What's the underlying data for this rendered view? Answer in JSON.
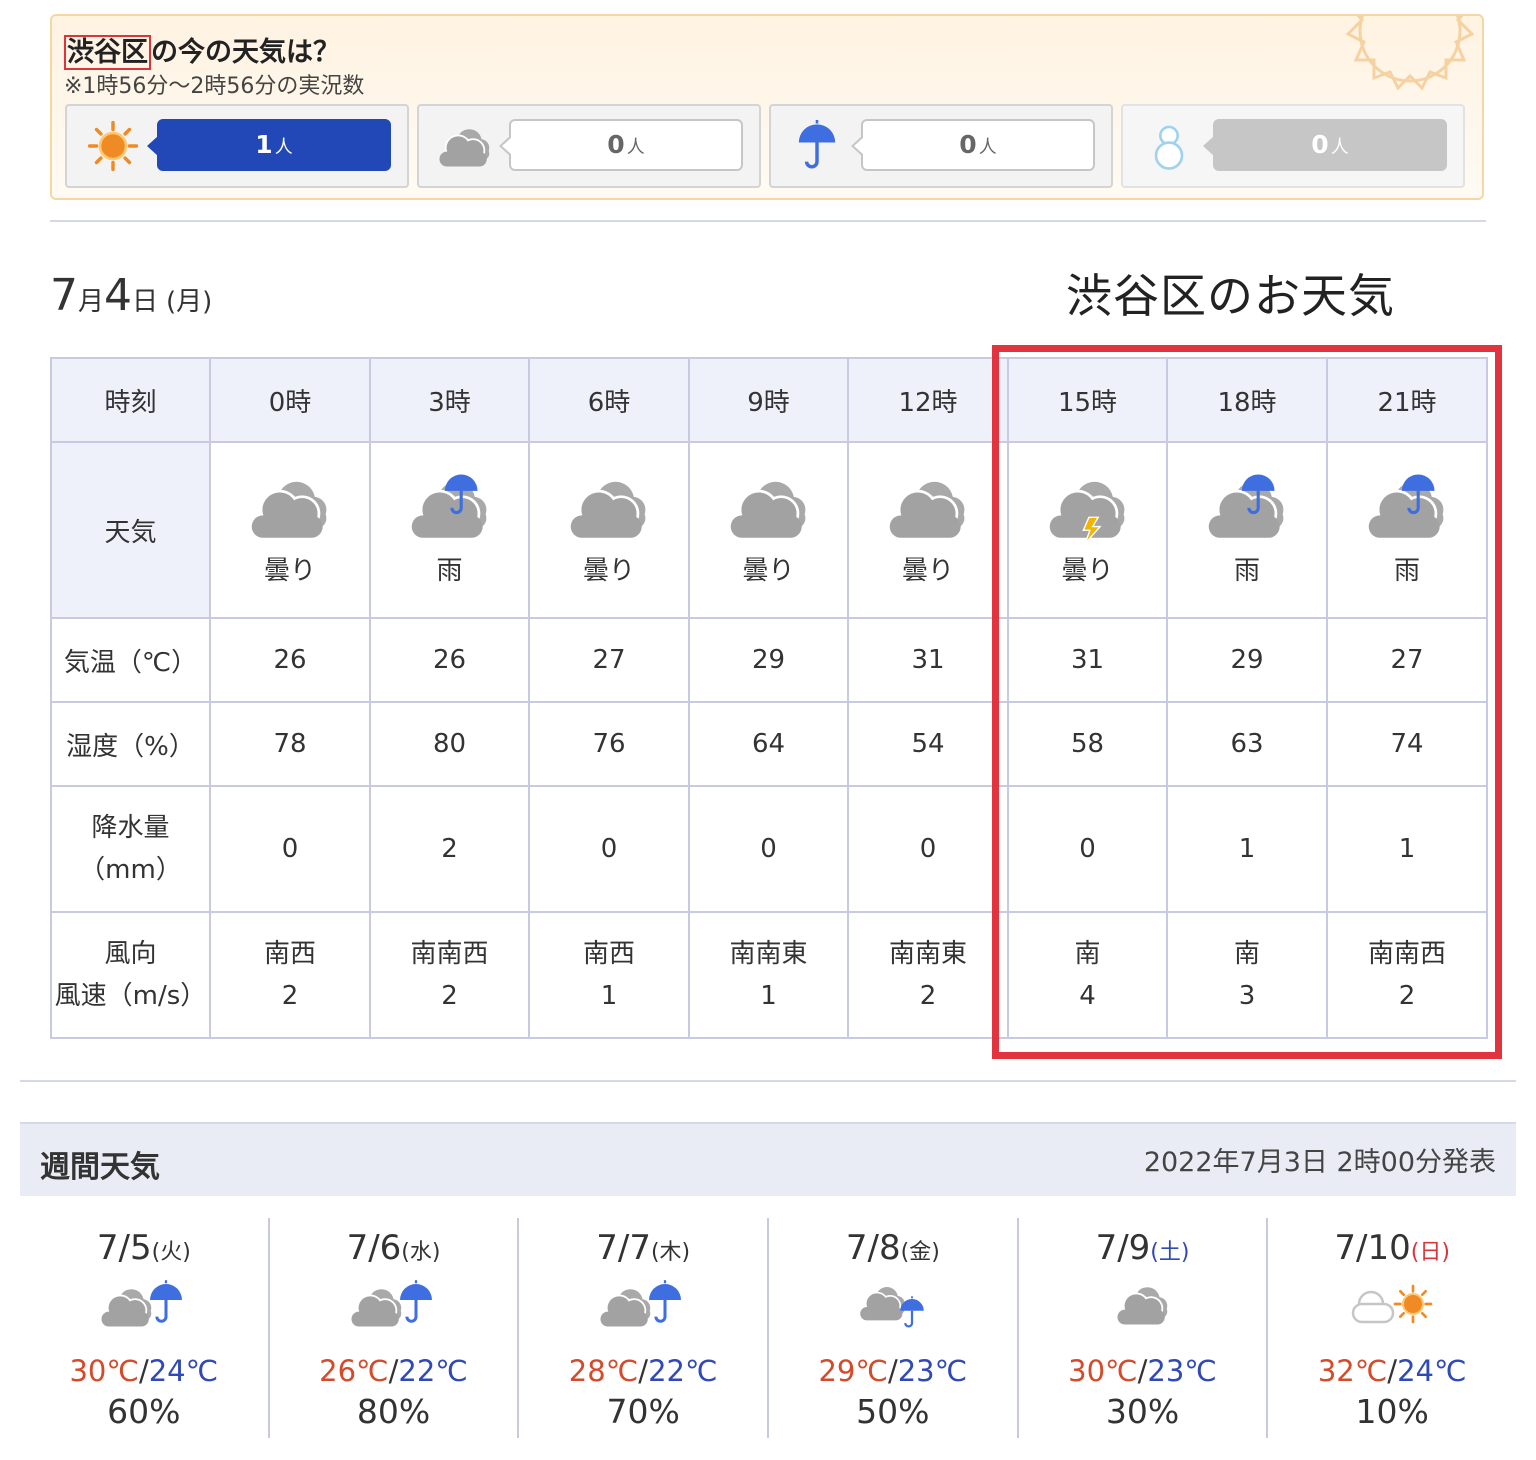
{
  "live": {
    "place": "渋谷区",
    "title_suffix": "の今の天気は？",
    "subtitle": "※1時56分〜2時56分の実況数",
    "unit": "人",
    "votes": [
      {
        "icon": "sun-icon",
        "count": "1"
      },
      {
        "icon": "cloud-icon",
        "count": "0"
      },
      {
        "icon": "umbrella-icon",
        "count": "0"
      },
      {
        "icon": "snowman-icon",
        "count": "0"
      }
    ]
  },
  "date": {
    "month": "7",
    "month_unit": "月",
    "day": "4",
    "day_unit": "日",
    "dow": "(月)"
  },
  "annotation": "渋谷区のお天気",
  "hourly": {
    "labels": {
      "time": "時刻",
      "weather": "天気",
      "temp": "気温（℃）",
      "humidity": "湿度（%）",
      "precip_1": "降水量",
      "precip_2": "（mm）",
      "wind_1": "風向",
      "wind_2": "風速（m/s）"
    },
    "columns": [
      {
        "time": "0時",
        "icon": "cloud-icon",
        "weather": "曇り",
        "temp": "26",
        "humidity": "78",
        "precip": "0",
        "wind_dir": "南西",
        "wind_speed": "2"
      },
      {
        "time": "3時",
        "icon": "rain-icon",
        "weather": "雨",
        "temp": "26",
        "humidity": "80",
        "precip": "2",
        "wind_dir": "南南西",
        "wind_speed": "2"
      },
      {
        "time": "6時",
        "icon": "cloud-icon",
        "weather": "曇り",
        "temp": "27",
        "humidity": "76",
        "precip": "0",
        "wind_dir": "南西",
        "wind_speed": "1"
      },
      {
        "time": "9時",
        "icon": "cloud-icon",
        "weather": "曇り",
        "temp": "29",
        "humidity": "64",
        "precip": "0",
        "wind_dir": "南南東",
        "wind_speed": "1"
      },
      {
        "time": "12時",
        "icon": "cloud-icon",
        "weather": "曇り",
        "temp": "31",
        "humidity": "54",
        "precip": "0",
        "wind_dir": "南南東",
        "wind_speed": "2"
      },
      {
        "time": "15時",
        "icon": "thundercloud-icon",
        "weather": "曇り",
        "temp": "31",
        "humidity": "58",
        "precip": "0",
        "wind_dir": "南",
        "wind_speed": "4"
      },
      {
        "time": "18時",
        "icon": "rain-icon",
        "weather": "雨",
        "temp": "29",
        "humidity": "63",
        "precip": "1",
        "wind_dir": "南",
        "wind_speed": "3"
      },
      {
        "time": "21時",
        "icon": "rain-icon",
        "weather": "雨",
        "temp": "27",
        "humidity": "74",
        "precip": "1",
        "wind_dir": "南南西",
        "wind_speed": "2"
      }
    ]
  },
  "weekly": {
    "title": "週間天気",
    "published": "2022年7月3日 2時00分発表",
    "days": [
      {
        "date": "7/5",
        "dow": "(火)",
        "icon": "cloud-then-rain-icon",
        "high": "30℃",
        "low": "24℃",
        "pop": "60%"
      },
      {
        "date": "7/6",
        "dow": "(水)",
        "icon": "cloud-then-rain-icon",
        "high": "26℃",
        "low": "22℃",
        "pop": "80%"
      },
      {
        "date": "7/7",
        "dow": "(木)",
        "icon": "cloud-then-rain-icon",
        "high": "28℃",
        "low": "22℃",
        "pop": "70%"
      },
      {
        "date": "7/8",
        "dow": "(金)",
        "icon": "cloud-occasional-rain-icon",
        "high": "29℃",
        "low": "23℃",
        "pop": "50%"
      },
      {
        "date": "7/9",
        "dow": "(土)",
        "icon": "cloud-icon",
        "high": "30℃",
        "low": "23℃",
        "pop": "30%"
      },
      {
        "date": "7/10",
        "dow": "(日)",
        "icon": "cloud-then-sun-icon",
        "high": "32℃",
        "low": "24℃",
        "pop": "10%"
      }
    ],
    "separator": "/"
  },
  "colors": {
    "accent_blue": "#2248b8",
    "highlight_red": "#e2343f",
    "high_temp": "#d54a2a",
    "low_temp": "#2f49b8"
  }
}
